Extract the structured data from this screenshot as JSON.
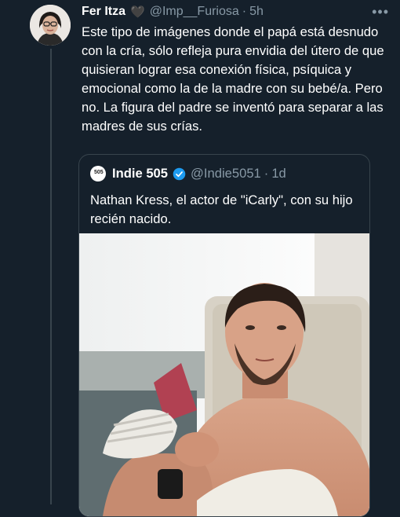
{
  "tweet": {
    "author_name": "Fer Itza",
    "heart_emoji": "🖤",
    "handle": "@Imp__Furiosa",
    "separator": "·",
    "time": "5h",
    "more": "•••",
    "text": "Este tipo de imágenes donde el papá está desnudo con la cría, sólo refleja pura envidia del útero de que quisieran lograr esa conexión física, psíquica y emocional como la de la madre con su bebé/a. Pero no. La figura del padre se inventó para separar a las madres de sus crías."
  },
  "quote": {
    "avatar_text": "505",
    "author_name": "Indie 505",
    "handle": "@Indie5051",
    "separator": "·",
    "time": "1d",
    "text": "Nathan Kress, el actor  de \"iCarly\", con su hijo recién nacido."
  },
  "colors": {
    "background": "#15202b",
    "text": "#ffffff",
    "muted": "#8899a6",
    "border": "#38444d",
    "verified": "#1d9bf0"
  },
  "icons": [
    "avatar-photo",
    "heart-emoji",
    "more-icon",
    "verified-badge-icon"
  ]
}
